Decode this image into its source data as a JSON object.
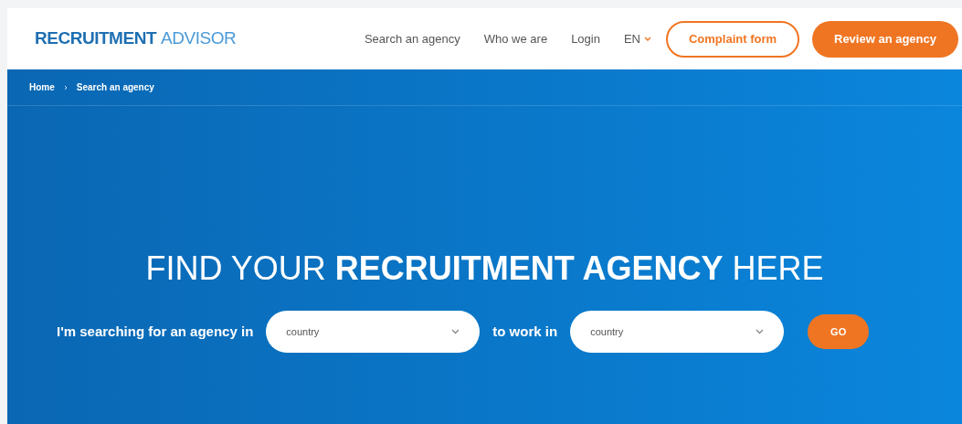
{
  "header": {
    "logo_bold": "RECRUITMENT",
    "logo_light": "ADVISOR",
    "nav": [
      "Search an agency",
      "Who we are",
      "Login"
    ],
    "language": "EN",
    "buttons": [
      {
        "label": "Complaint form",
        "kind": "outline"
      },
      {
        "label": "Review an agency",
        "kind": "filled"
      }
    ]
  },
  "breadcrumb": [
    "Home",
    "Search an agency"
  ],
  "hero": {
    "title": "FIND YOUR **RECRUITMENT AGENCY** HERE",
    "search": {
      "label_1": "I'm searching for an agency in",
      "select_1": {
        "placeholder": "country"
      },
      "label_2": "to work in",
      "select_2": {
        "placeholder": "country"
      },
      "button": "GO"
    }
  }
}
